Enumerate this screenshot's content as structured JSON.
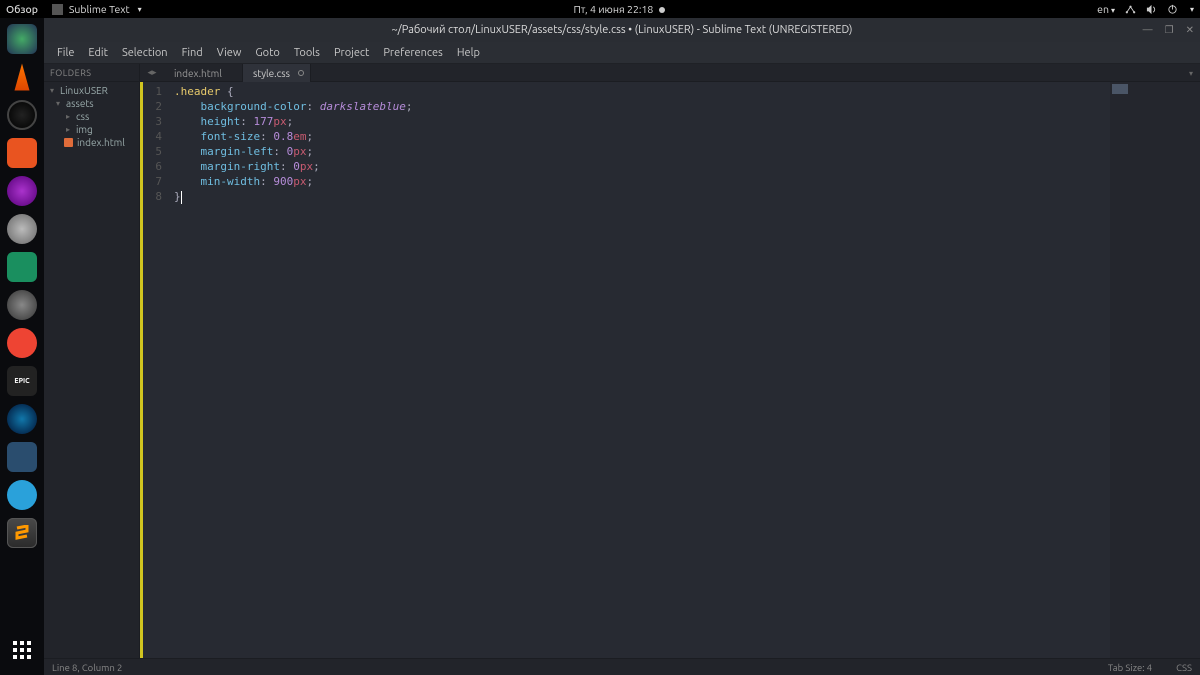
{
  "sysbar": {
    "overview": "Обзор",
    "appname": "Sublime Text",
    "datetime": "Пт, 4 июня  22:18",
    "lang": "en"
  },
  "titlebar": "~/Рабочий стол/LinuxUSER/assets/css/style.css • (LinuxUSER) - Sublime Text (UNREGISTERED)",
  "menu": [
    "File",
    "Edit",
    "Selection",
    "Find",
    "View",
    "Goto",
    "Tools",
    "Project",
    "Preferences",
    "Help"
  ],
  "sidebar": {
    "header": "FOLDERS",
    "project": "LinuxUSER",
    "assets": "assets",
    "css": "css",
    "img": "img",
    "indexhtml": "index.html"
  },
  "tabs": {
    "t1": "index.html",
    "t2": "style.css"
  },
  "code": {
    "l1_sel": ".header",
    "l1_brace": " {",
    "l2_p": "background-color",
    "l2_v": "darkslateblue",
    "l3_p": "height",
    "l3_v": "177",
    "l3_u": "px",
    "l4_p": "font-size",
    "l4_v": "0.8",
    "l4_u": "em",
    "l5_p": "margin-left",
    "l5_v": "0",
    "l5_u": "px",
    "l6_p": "margin-right",
    "l6_v": "0",
    "l6_u": "px",
    "l7_p": "min-width",
    "l7_v": "900",
    "l7_u": "px",
    "l8": "}"
  },
  "gutter": [
    "1",
    "2",
    "3",
    "4",
    "5",
    "6",
    "7",
    "8"
  ],
  "status": {
    "pos": "Line 8, Column 2",
    "tabsize": "Tab Size: 4",
    "lang": "CSS"
  },
  "dock_icons": [
    "browser",
    "vlc",
    "obs",
    "software",
    "development",
    "updater",
    "hardware",
    "settings",
    "reddit",
    "epic",
    "steam",
    "battle-net",
    "telegram",
    "sublime"
  ]
}
